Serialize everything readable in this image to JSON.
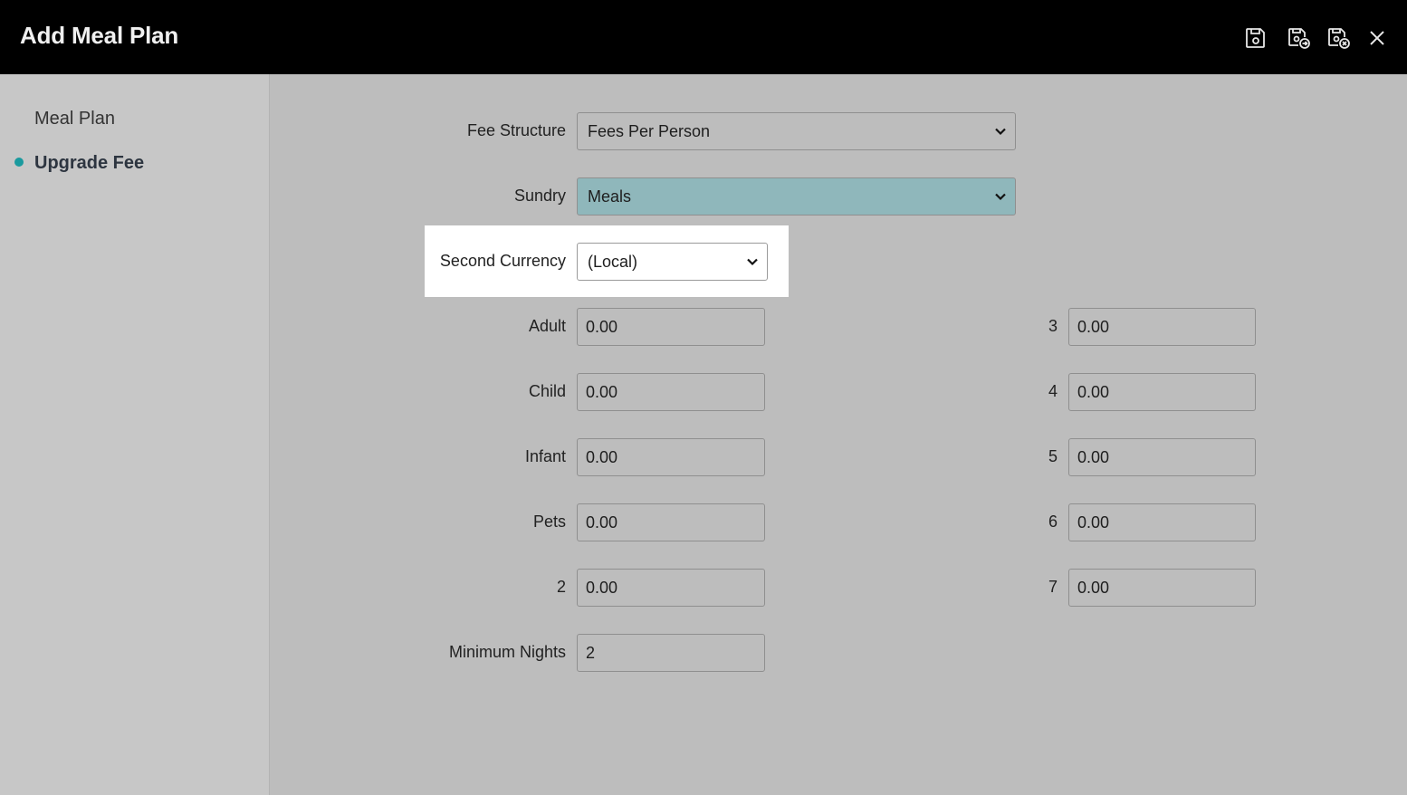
{
  "header": {
    "title": "Add Meal Plan",
    "icons": [
      "save-icon",
      "save-and-continue-icon",
      "save-and-close-icon",
      "close-icon"
    ]
  },
  "sidebar": {
    "items": [
      {
        "label": "Meal Plan"
      },
      {
        "label": "Upgrade Fee"
      }
    ],
    "active_color": "#1a9a9e"
  },
  "form": {
    "fee_structure": {
      "label": "Fee Structure",
      "value": "Fees Per Person"
    },
    "sundry": {
      "label": "Sundry",
      "value": "Meals"
    },
    "second_currency": {
      "label": "Second Currency",
      "value": "(Local)"
    },
    "adult": {
      "label": "Adult",
      "value": "0.00"
    },
    "child": {
      "label": "Child",
      "value": "0.00"
    },
    "infant": {
      "label": "Infant",
      "value": "0.00"
    },
    "pets": {
      "label": "Pets",
      "value": "0.00"
    },
    "p2": {
      "label": "2",
      "value": "0.00"
    },
    "p3": {
      "label": "3",
      "value": "0.00"
    },
    "p4": {
      "label": "4",
      "value": "0.00"
    },
    "p5": {
      "label": "5",
      "value": "0.00"
    },
    "p6": {
      "label": "6",
      "value": "0.00"
    },
    "p7": {
      "label": "7",
      "value": "0.00"
    },
    "minimum_nights": {
      "label": "Minimum Nights",
      "value": "2"
    }
  }
}
